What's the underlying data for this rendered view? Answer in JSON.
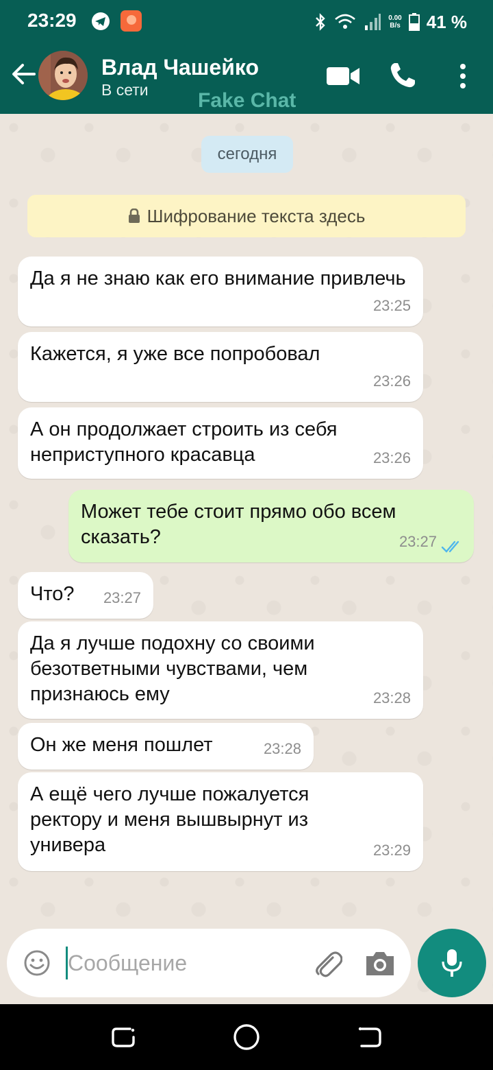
{
  "status_bar": {
    "time": "23:29",
    "net_speed_value": "0.00",
    "net_speed_unit": "B/s",
    "battery_percent": "41 %",
    "icons": [
      "telegram-icon",
      "notification-app-icon",
      "bluetooth-icon",
      "wifi-icon",
      "signal-icon",
      "battery-icon"
    ]
  },
  "header": {
    "contact_name": "Влад Чашейко",
    "presence": "В сети",
    "watermark": "Fake Chat",
    "actions": [
      "video-call-icon",
      "phone-icon",
      "more-options-icon"
    ]
  },
  "chat": {
    "date_divider": "сегодня",
    "encryption_notice": "Шифрование текста здесь",
    "messages": [
      {
        "direction": "in",
        "text": "Да я не знаю как его внимание привлечь",
        "time": "23:25"
      },
      {
        "direction": "in",
        "text": "Кажется, я уже все попробовал",
        "time": "23:26"
      },
      {
        "direction": "in",
        "text": "А он продолжает строить из себя неприступного красавца",
        "time": "23:26"
      },
      {
        "direction": "out",
        "text": "Может тебе стоит прямо обо всем сказать?",
        "time": "23:27",
        "status": "read"
      },
      {
        "direction": "in",
        "text": "Что?",
        "time": "23:27"
      },
      {
        "direction": "in",
        "text": "Да я лучше подохну со своими безответными чувствами, чем признаюсь ему",
        "time": "23:28"
      },
      {
        "direction": "in",
        "text": "Он же меня пошлет",
        "time": "23:28"
      },
      {
        "direction": "in",
        "text": "А ещё чего лучше пожалуется ректору и меня вышвырнут из универа",
        "time": "23:29"
      }
    ]
  },
  "composer": {
    "placeholder": "Сообщение",
    "value": ""
  },
  "colors": {
    "header": "#075e54",
    "accent": "#128c7e",
    "incoming_bubble": "#ffffff",
    "outgoing_bubble": "#dcf8c6",
    "read_ticks": "#4fb6ec",
    "chat_background": "#ece5dd"
  }
}
